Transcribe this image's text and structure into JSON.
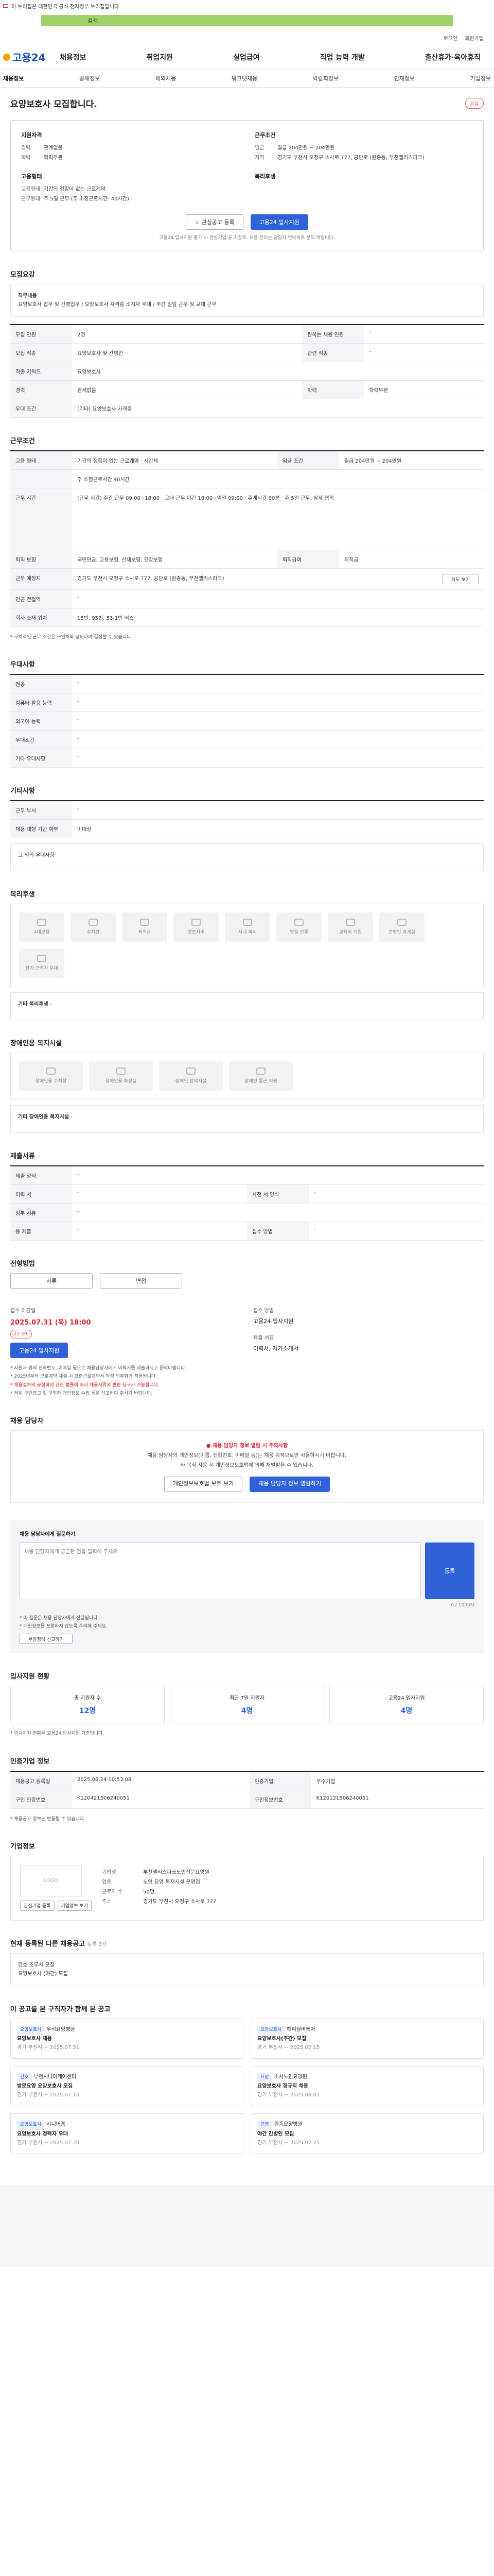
{
  "topbar": {
    "text": "이 누리집은 대한민국 공식 전자정부 누리집입니다."
  },
  "banner": {
    "text": "검색"
  },
  "util": [
    "로그인",
    "회원가입"
  ],
  "gnb": {
    "logo": "고용24",
    "items": [
      "채용정보",
      "취업지원",
      "실업급여",
      "직업 능력 개발",
      "출산휴가·육아휴직"
    ]
  },
  "subnav": {
    "items": [
      "채용정보",
      "공채정보",
      "해외채용",
      "워크넷채용",
      "박람회정보",
      "인재정보",
      "기업정보"
    ]
  },
  "title": "요양보호사 모집합니다.",
  "share": "공유",
  "overview": {
    "left_title": "지원자격",
    "left": [
      {
        "k": "경력",
        "v": "관계없음"
      },
      {
        "k": "학력",
        "v": "학력무관"
      }
    ],
    "right_title": "근무조건",
    "right": [
      {
        "k": "임금",
        "v": "월급 204만원 ~ 204만원"
      },
      {
        "k": "지역",
        "v": "경기도 부천시 오정구 소사로 777, 공단로 (원종동, 부천엘리스파크)"
      }
    ],
    "left2_title": "고용형태",
    "left2": [
      {
        "k": "고용형태",
        "v": "기간의 정함이 없는 근로계약"
      },
      {
        "k": "근무형태",
        "v": "주 5일 근무 (주 소정근로시간: 40시간)"
      }
    ],
    "right2_title": "복리후생",
    "right2": [],
    "btn_scrap": "관심공고 등록",
    "btn_apply": "고용24 입사지원",
    "note": "고용24 입사지원 불가 시 관심기업 공고 참조, 채용 문의는 담당자 연락처로 문의 바랍니다."
  },
  "sec_recruit": {
    "title": "모집요강",
    "job_desc_title": "직무내용",
    "job_desc": "요양보호사 업무 및 간병업무 / 요양보호사 자격증 소지자 우대 / 주간 일일 근무 및 교대 근무",
    "rows": [
      {
        "k": "모집 인원",
        "v": "2명",
        "k2": "원하는 채용 인원",
        "v2": "-"
      },
      {
        "k": "모집 직종",
        "v": "요양보호사 및 간병인",
        "k2": "관련 직종",
        "v2": "-"
      },
      {
        "k": "직종 키워드",
        "v": "요양보호사",
        "k2": "",
        "v2": ""
      },
      {
        "k": "경력",
        "v": "관계없음",
        "k2": "학력",
        "v2": "학력무관"
      },
      {
        "k": "우대 조건",
        "v": "(기타) 요양보호사 자격증",
        "k2": "",
        "v2": ""
      }
    ]
  },
  "sec_work": {
    "title": "근무조건",
    "rows": [
      {
        "k": "고용 형태",
        "v": "기간의 정함이 없는 근로계약 · 시간제",
        "k2": "임금 조건",
        "v2": "월급 204만원 ~ 204만원"
      },
      {
        "k": "",
        "v": "주 소정근로시간 40시간",
        "k2": "",
        "v2": ""
      },
      {
        "k": "근무 시간",
        "v": "(근무 시간) 주간 근무 09:00~18:00 · 교대 근무 야간 18:00~익일 09:00 · 휴게시간 60분 · 주 5일 근무, 상세 협의",
        "k2": "",
        "v2": ""
      },
      {
        "k": "퇴직 보험",
        "v": "국민연금, 고용보험, 산재보험, 건강보험",
        "k2": "퇴직급여",
        "v2": "퇴직금"
      },
      {
        "k": "근무 예정지",
        "v": "경기도 부천시 오정구 소사로 777, 공단로 (원종동, 부천엘리스파크)",
        "k2": "",
        "v2": ""
      },
      {
        "k": "인근 전철역",
        "v": "-",
        "k2": "",
        "v2": ""
      },
      {
        "k": "회사 소재 위치",
        "v": "15번, 95번, 53-1번 버스",
        "k2": "",
        "v2": ""
      }
    ],
    "map_btn": "지도 보기",
    "note": "* 구체적인 근무 조건은 구인처와 상의하여 결정할 수 있습니다."
  },
  "sec_pref": {
    "title": "우대사항",
    "rows": [
      {
        "k": "전공",
        "v": "-"
      },
      {
        "k": "컴퓨터 활용 능력",
        "v": "-"
      },
      {
        "k": "외국어 능력",
        "v": "-"
      },
      {
        "k": "우대조건",
        "v": "-"
      },
      {
        "k": "기타 우대사항",
        "v": "-"
      }
    ]
  },
  "sec_etc": {
    "title": "기타사항",
    "rows": [
      {
        "k": "근무 부서",
        "v": "-"
      },
      {
        "k": "채용 대행 기관 여부",
        "v": "미대상"
      }
    ],
    "extra": "그 외의 우대사항"
  },
  "sec_benefit": {
    "title": "복리후생",
    "items": [
      "4대보험",
      "주차장",
      "퇴직금",
      "경조사비",
      "사내 복지",
      "명절 선물",
      "교육비 지원",
      "간병인 휴게실",
      "장기 근속자 우대"
    ],
    "etc_title": "기타 복리후생",
    "etc": "-"
  },
  "sec_disabled": {
    "title": "장애인용 복지시설",
    "items": [
      "장애인용 주차장",
      "장애인용 화장실",
      "장애인 편의시설",
      "장애인 통근 지원"
    ],
    "etc_title": "기타 장애인용 복지시설",
    "etc": "-"
  },
  "sec_docs": {
    "title": "제출서류",
    "rows": [
      {
        "k": "제출 양식",
        "v": "-",
        "k2": "",
        "v2": ""
      },
      {
        "k": "이력 서",
        "v": "-",
        "k2": "사전 서 양식",
        "v2": "-"
      },
      {
        "k": "첨부 서류",
        "v": "-",
        "k2": "",
        "v2": ""
      },
      {
        "k": "응 제출",
        "v": "-",
        "k2": "접수 방법",
        "v2": "-"
      }
    ]
  },
  "sec_process": {
    "title": "전형방법",
    "steps": [
      "서류",
      "면접"
    ]
  },
  "sec_apply": {
    "deadline_label": "접수 마감일",
    "deadline": "2025.07.31 (목) 18:00",
    "deadline_badge": "D-39",
    "method_label": "접수 방법",
    "method": "고용24 입사지원",
    "apply_btn": "고용24 입사지원",
    "doc_label": "제출 서류",
    "doc": "이력서, 자기소개서",
    "bullets": [
      "* 지원자 명의 전화번호, 이메일 등으로 채용담당자에게 이력서를 제출하시고 문의바랍니다.",
      "* 2025년부터 근로계약 체결 시 표준근로계약서 작성 의무화가 적용됩니다.",
      "* 채용절차의 공정화에 관한 법률에 따라 채용서류의 반환 청구가 가능합니다.",
      "* 허위 구인광고 및 구직자 개인정보 수집 등은 신고하여 주시기 바랍니다."
    ]
  },
  "sec_contact": {
    "title": "채용 담당자",
    "warn": "채용 담당자 정보 열람 시 주의사항",
    "lines": [
      "채용 담당자의 개인정보(이름, 전화번호, 이메일 등)는 채용 목적으로만 사용하시기 바랍니다.",
      "타 목적 사용 시 개인정보보호법에 의해 처벌받을 수 있습니다."
    ],
    "btn1": "개인정보보호법 보호 보기",
    "btn2": "채용 담당자 정보 열람하기"
  },
  "sec_inquiry": {
    "title": "채용 담당자에게 질문하기",
    "placeholder": "채용 담당자에게 궁금한 점을 입력해 주세요.",
    "counter": "0 / 1000자",
    "send": "등록",
    "notes": [
      "* 이 질문은 채용 담당자에게 전달됩니다.",
      "* 개인정보를 포함하지 않도록 주의해 주세요."
    ],
    "report_btn": "부정청탁 신고하기"
  },
  "sec_status": {
    "title": "입사지원 현황",
    "stats": [
      {
        "k": "총 지원자 수",
        "v": "12명"
      },
      {
        "k": "최근 7일 지원자",
        "v": "4명"
      },
      {
        "k": "고용24 입사지원",
        "v": "4명"
      }
    ],
    "note": "* 입사지원 현황은 고용24 입사지원 기준입니다."
  },
  "sec_reg": {
    "title": "인증기업 정보",
    "rows": [
      {
        "k": "채용공고 등록일",
        "v": "2025.06.24 10:53:08",
        "k2": "인증기업",
        "v2": "우수기업"
      },
      {
        "k": "구인 인증번호",
        "v": "K120421506240051",
        "k2": "구인정보번호",
        "v2": "K120121506240051"
      }
    ],
    "note": "* 채용공고 정보는 변동될 수 있습니다."
  },
  "sec_company": {
    "title": "기업정보",
    "logo": "LOGO",
    "name": "부천엘리스파크",
    "rows": [
      {
        "k": "기업명",
        "v": "부천엘리스파크노인전문요양원"
      },
      {
        "k": "업종",
        "v": "노인 요양 복지시설 운영업"
      },
      {
        "k": "근로자 수",
        "v": "50명"
      },
      {
        "k": "주소",
        "v": "경기도 부천시 오정구 소사로 777"
      }
    ],
    "btns": [
      "관심기업 등록",
      "기업정보 보기"
    ]
  },
  "sec_more": {
    "title": "현재 등록된 다른 채용공고",
    "count": "등록 3건",
    "items": [
      "간호 조무사 모집",
      "요양보호사 (야간) 모집"
    ]
  },
  "sec_reco": {
    "title": "이 공고를 본 구직자가 함께 본 공고",
    "cards": [
      {
        "tag": "요양보호사",
        "co": "우리요양병원",
        "title": "요양보호사 채용",
        "loc": "경기 부천시",
        "date": "~ 2025.07.31"
      },
      {
        "tag": "요양보호사",
        "co": "해피실버케어",
        "title": "요양보호사(주간) 모집",
        "loc": "경기 부천시",
        "date": "~ 2025.07.15"
      },
      {
        "tag": "간호",
        "co": "부천시니어케어센터",
        "title": "방문요양 요양보호사 모집",
        "loc": "경기 부천시",
        "date": "~ 2025.07.10"
      },
      {
        "tag": "요양",
        "co": "소사노인요양원",
        "title": "요양보호사 정규직 채용",
        "loc": "경기 부천시",
        "date": "~ 2025.08.01"
      },
      {
        "tag": "요양보호사",
        "co": "시니어홈",
        "title": "요양보호사 경력자 우대",
        "loc": "경기 부천시",
        "date": "~ 2025.07.20"
      },
      {
        "tag": "간병",
        "co": "원종요양병원",
        "title": "야간 간병인 모집",
        "loc": "경기 부천시",
        "date": "~ 2025.07.25"
      }
    ]
  }
}
